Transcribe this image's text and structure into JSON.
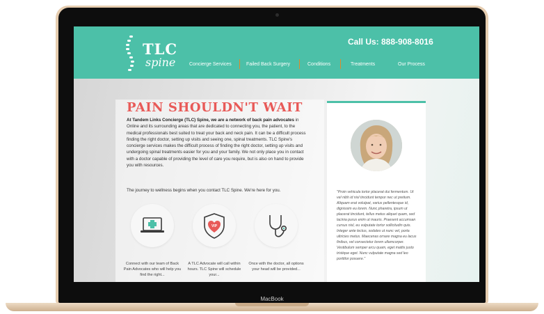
{
  "device": {
    "brand_label": "MacBook"
  },
  "site": {
    "logo": {
      "line1": "TLC",
      "line2": "spine"
    },
    "phone": "Call Us: 888-908-8016",
    "nav": [
      "Concierge Services",
      "Failed Back Surgery",
      "Conditions",
      "Treatments",
      "Our Process"
    ],
    "headline": "PAIN SHOULDN'T WAIT",
    "intro_lead": "At Tandem Links Concierge (TLC) Spine, we are a network of back pain advocates",
    "intro_rest": "in Online and its surrounding areas that are dedicated to connecting you, the patient, to the medical professionals best suited to treat your back and neck pain. It can be a difficult process finding the right doctor, setting up visits and seeing one, spinal treatments. TLC Spine's concierge services makes the difficult process of finding the right doctor, setting up visits and undergoing spinal treatments easier for you and your family. We not only place you in contact with a doctor capable of providing the level of care you require, but is also on hand to provide you with resources.",
    "journey": "The journey to wellness begins when you contact TLC Spine. We're here for you.",
    "features": [
      {
        "icon": "laptop-medical-icon",
        "caption": "Connect with our team of Back Pain Advocates who will help you find the right..."
      },
      {
        "icon": "shield-vip-icon",
        "caption": "A TLC Advocate will call within hours. TLC Spine will schedule your..."
      },
      {
        "icon": "stethoscope-icon",
        "caption": "Once with the doctor, all options your head will be provided..."
      }
    ],
    "testimonial": "\"Proin vehicula tortor placerat dui fermentum. Ut vel nibh id nisl tincidunt tempor nec ut pretium. Aliquam erat volutpat, varius pellentesque id, dignissim eu lorem. Nunc pharetra, ipsum ut placerat tincidunt, tellus metus aliquet quam, sed lacinia purus enim ut mauris. Praesent accumsan cursus nisl, eu vulputate tortor sollicitudin quis. Integer ante lectus, sodales ut nunc vel, porta ultricies metus. Maecenas ornare magna eu lacus finibus, vel consectetur lorem ullamcorper. Vestibulum semper arcu quam, eget mattis justo tristique eget. Nunc vulputate magna sed leo porttitor posuere.\""
  },
  "colors": {
    "teal": "#4cc0a8",
    "accent_orange": "#e08a2a",
    "headline_red": "#e85a58",
    "laptop_gold": "#e6cdb0"
  }
}
